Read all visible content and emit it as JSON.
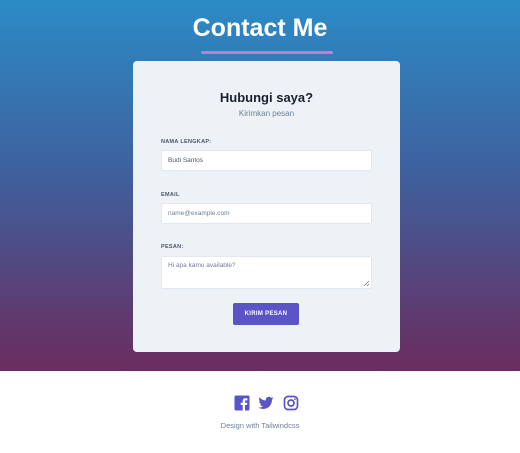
{
  "header": {
    "title": "Contact Me",
    "underline_color": "#c57bd6",
    "gradient": [
      "#2b8bc6",
      "#3f5f9c",
      "#6a2c5e"
    ]
  },
  "card": {
    "title": "Hubungi saya?",
    "subtitle": "Kirimkan pesan"
  },
  "form": {
    "name_label": "NAMA LENGKAP:",
    "name_value": "Budi Santos",
    "email_label": "EMAIL",
    "email_placeholder": "name@example.com",
    "message_label": "PESAN:",
    "message_placeholder": "Hi apa kamu available?",
    "submit_label": "KIRIM PESAN",
    "submit_color": "#5a54c6"
  },
  "footer": {
    "icons": [
      "facebook-icon",
      "twitter-icon",
      "instagram-icon"
    ],
    "icon_color": "#5a54c6",
    "text": "Design with Tailwindcss"
  }
}
